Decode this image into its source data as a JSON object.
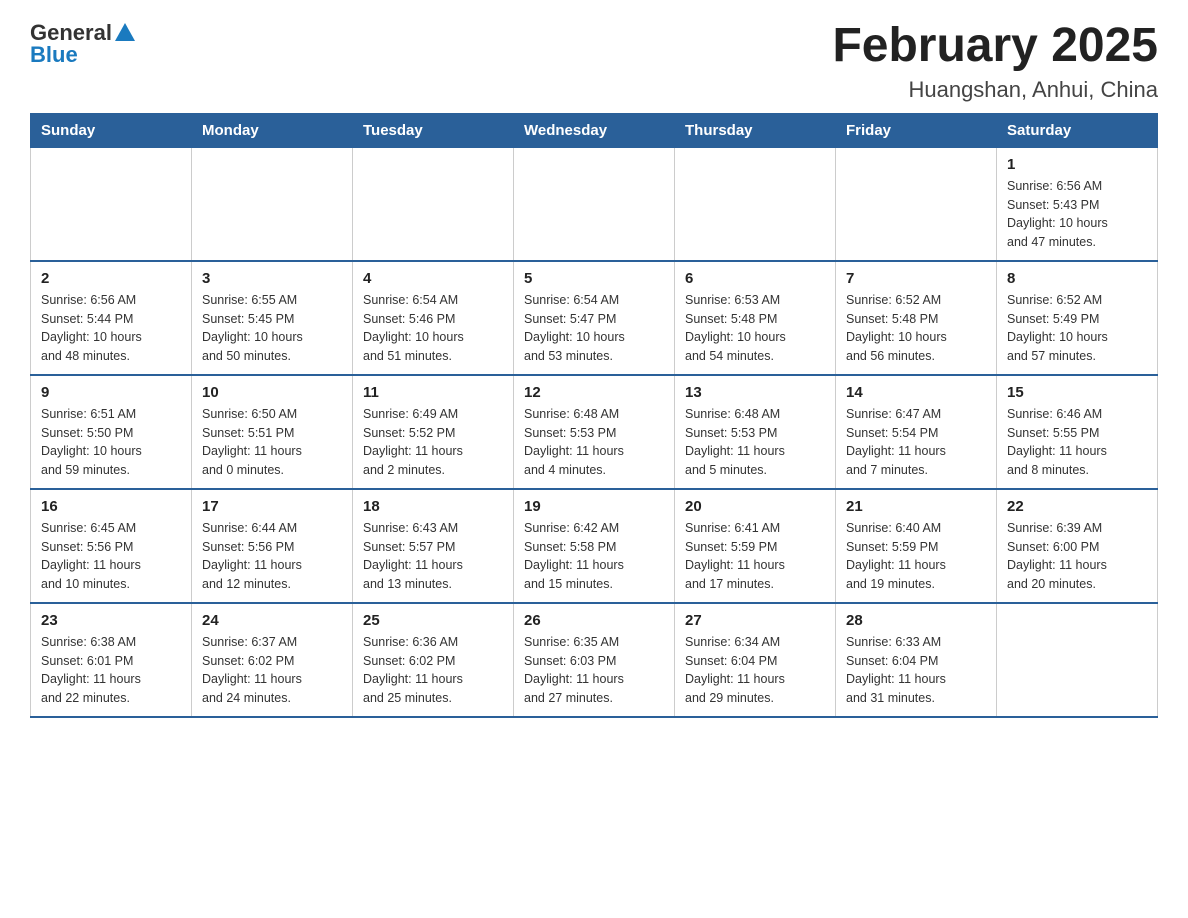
{
  "logo": {
    "general": "General",
    "blue": "Blue"
  },
  "title": "February 2025",
  "subtitle": "Huangshan, Anhui, China",
  "weekdays": [
    "Sunday",
    "Monday",
    "Tuesday",
    "Wednesday",
    "Thursday",
    "Friday",
    "Saturday"
  ],
  "weeks": [
    [
      {
        "day": "",
        "info": ""
      },
      {
        "day": "",
        "info": ""
      },
      {
        "day": "",
        "info": ""
      },
      {
        "day": "",
        "info": ""
      },
      {
        "day": "",
        "info": ""
      },
      {
        "day": "",
        "info": ""
      },
      {
        "day": "1",
        "info": "Sunrise: 6:56 AM\nSunset: 5:43 PM\nDaylight: 10 hours\nand 47 minutes."
      }
    ],
    [
      {
        "day": "2",
        "info": "Sunrise: 6:56 AM\nSunset: 5:44 PM\nDaylight: 10 hours\nand 48 minutes."
      },
      {
        "day": "3",
        "info": "Sunrise: 6:55 AM\nSunset: 5:45 PM\nDaylight: 10 hours\nand 50 minutes."
      },
      {
        "day": "4",
        "info": "Sunrise: 6:54 AM\nSunset: 5:46 PM\nDaylight: 10 hours\nand 51 minutes."
      },
      {
        "day": "5",
        "info": "Sunrise: 6:54 AM\nSunset: 5:47 PM\nDaylight: 10 hours\nand 53 minutes."
      },
      {
        "day": "6",
        "info": "Sunrise: 6:53 AM\nSunset: 5:48 PM\nDaylight: 10 hours\nand 54 minutes."
      },
      {
        "day": "7",
        "info": "Sunrise: 6:52 AM\nSunset: 5:48 PM\nDaylight: 10 hours\nand 56 minutes."
      },
      {
        "day": "8",
        "info": "Sunrise: 6:52 AM\nSunset: 5:49 PM\nDaylight: 10 hours\nand 57 minutes."
      }
    ],
    [
      {
        "day": "9",
        "info": "Sunrise: 6:51 AM\nSunset: 5:50 PM\nDaylight: 10 hours\nand 59 minutes."
      },
      {
        "day": "10",
        "info": "Sunrise: 6:50 AM\nSunset: 5:51 PM\nDaylight: 11 hours\nand 0 minutes."
      },
      {
        "day": "11",
        "info": "Sunrise: 6:49 AM\nSunset: 5:52 PM\nDaylight: 11 hours\nand 2 minutes."
      },
      {
        "day": "12",
        "info": "Sunrise: 6:48 AM\nSunset: 5:53 PM\nDaylight: 11 hours\nand 4 minutes."
      },
      {
        "day": "13",
        "info": "Sunrise: 6:48 AM\nSunset: 5:53 PM\nDaylight: 11 hours\nand 5 minutes."
      },
      {
        "day": "14",
        "info": "Sunrise: 6:47 AM\nSunset: 5:54 PM\nDaylight: 11 hours\nand 7 minutes."
      },
      {
        "day": "15",
        "info": "Sunrise: 6:46 AM\nSunset: 5:55 PM\nDaylight: 11 hours\nand 8 minutes."
      }
    ],
    [
      {
        "day": "16",
        "info": "Sunrise: 6:45 AM\nSunset: 5:56 PM\nDaylight: 11 hours\nand 10 minutes."
      },
      {
        "day": "17",
        "info": "Sunrise: 6:44 AM\nSunset: 5:56 PM\nDaylight: 11 hours\nand 12 minutes."
      },
      {
        "day": "18",
        "info": "Sunrise: 6:43 AM\nSunset: 5:57 PM\nDaylight: 11 hours\nand 13 minutes."
      },
      {
        "day": "19",
        "info": "Sunrise: 6:42 AM\nSunset: 5:58 PM\nDaylight: 11 hours\nand 15 minutes."
      },
      {
        "day": "20",
        "info": "Sunrise: 6:41 AM\nSunset: 5:59 PM\nDaylight: 11 hours\nand 17 minutes."
      },
      {
        "day": "21",
        "info": "Sunrise: 6:40 AM\nSunset: 5:59 PM\nDaylight: 11 hours\nand 19 minutes."
      },
      {
        "day": "22",
        "info": "Sunrise: 6:39 AM\nSunset: 6:00 PM\nDaylight: 11 hours\nand 20 minutes."
      }
    ],
    [
      {
        "day": "23",
        "info": "Sunrise: 6:38 AM\nSunset: 6:01 PM\nDaylight: 11 hours\nand 22 minutes."
      },
      {
        "day": "24",
        "info": "Sunrise: 6:37 AM\nSunset: 6:02 PM\nDaylight: 11 hours\nand 24 minutes."
      },
      {
        "day": "25",
        "info": "Sunrise: 6:36 AM\nSunset: 6:02 PM\nDaylight: 11 hours\nand 25 minutes."
      },
      {
        "day": "26",
        "info": "Sunrise: 6:35 AM\nSunset: 6:03 PM\nDaylight: 11 hours\nand 27 minutes."
      },
      {
        "day": "27",
        "info": "Sunrise: 6:34 AM\nSunset: 6:04 PM\nDaylight: 11 hours\nand 29 minutes."
      },
      {
        "day": "28",
        "info": "Sunrise: 6:33 AM\nSunset: 6:04 PM\nDaylight: 11 hours\nand 31 minutes."
      },
      {
        "day": "",
        "info": ""
      }
    ]
  ]
}
